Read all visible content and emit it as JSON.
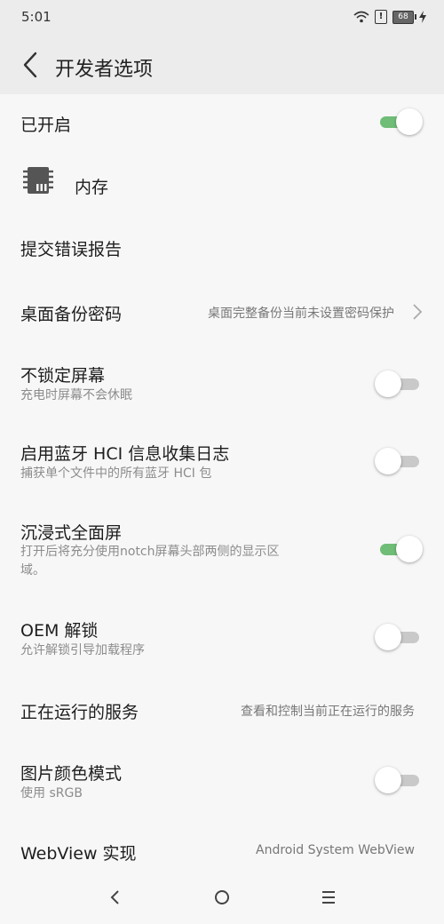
{
  "status": {
    "time": "5:01",
    "battery": "68",
    "alert": "!"
  },
  "header": {
    "title": "开发者选项"
  },
  "enabled": {
    "label": "已开启",
    "on": true
  },
  "memory": {
    "label": "内存",
    "icon": "memory-chip-icon"
  },
  "bug_report": {
    "label": "提交错误报告"
  },
  "backup_password": {
    "label": "桌面备份密码",
    "value": "桌面完整备份当前未设置密码保护"
  },
  "stay_awake": {
    "label": "不锁定屏幕",
    "desc": "充电时屏幕不会休眠",
    "on": false
  },
  "bt_hci": {
    "label": "启用蓝牙 HCI 信息收集日志",
    "desc": "捕获单个文件中的所有蓝牙 HCI 包",
    "on": false
  },
  "immersive": {
    "label": "沉浸式全面屏",
    "desc_line1": "打开后将充分使用notch屏幕头部两侧的显示区",
    "desc_line2": "域。",
    "on": true
  },
  "oem_unlock": {
    "label": "OEM 解锁",
    "desc": "允许解锁引导加载程序",
    "on": false
  },
  "running_services": {
    "label": "正在运行的服务",
    "value": "查看和控制当前正在运行的服务"
  },
  "picture_color": {
    "label": "图片颜色模式",
    "desc": "使用 sRGB",
    "on": false
  },
  "webview": {
    "label": "WebView 实现",
    "value": "Android System WebView"
  },
  "colors": {
    "toggle_on": "#6fbd77",
    "toggle_off": "#c9c9c9"
  }
}
